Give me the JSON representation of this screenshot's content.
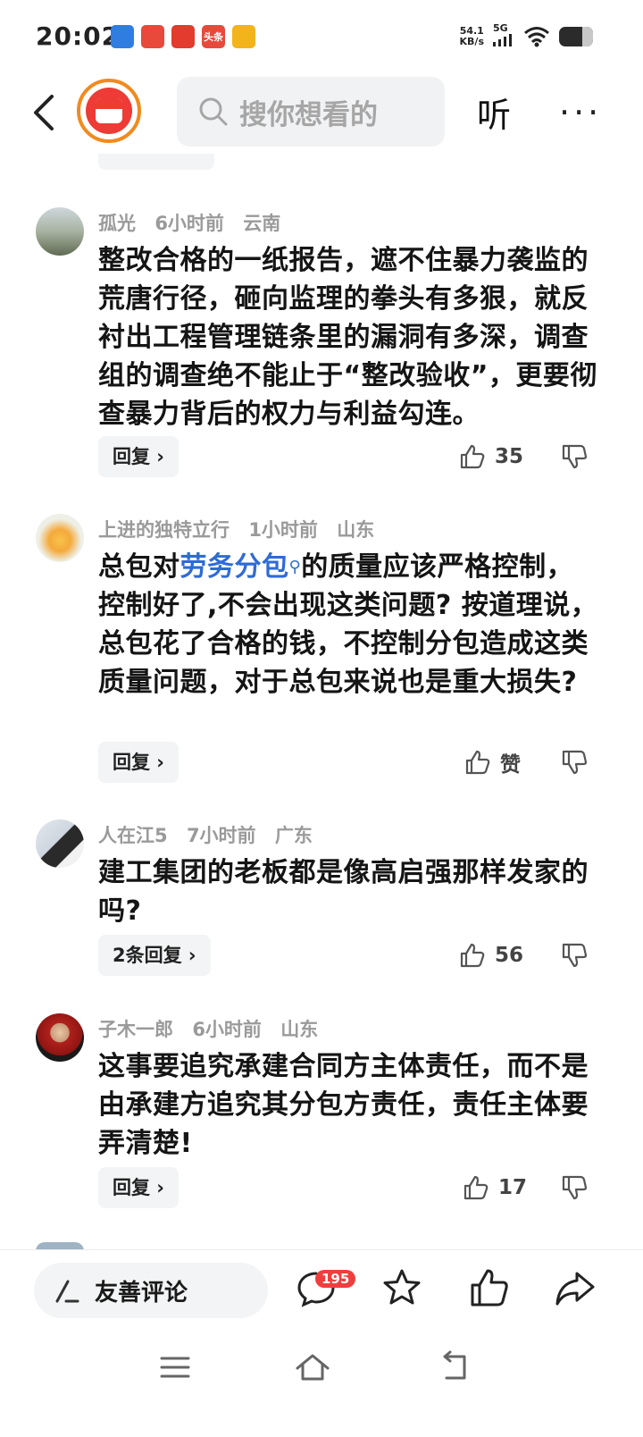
{
  "status_bar": {
    "time": "20:02",
    "net_speed_value": "54.1",
    "net_speed_unit": "KB/s",
    "network": "5G",
    "app_badges": [
      "头条"
    ]
  },
  "header": {
    "search_placeholder": "搜你想看的",
    "listen_label": "听",
    "more_label": "···"
  },
  "comments": [
    {
      "user": "孤光",
      "time": "6小时前",
      "location": "云南",
      "text": "整改合格的一纸报告，遮不住暴力袭监的荒唐行径，砸向监理的拳头有多狠，就反衬出工程管理链条里的漏洞有多深，调查组的调查绝不能止于“整改验收”，更要彻查暴力背后的权力与利益勾连。",
      "reply_label": "回复 ›",
      "likes": "35"
    },
    {
      "user": "上进的独特立行",
      "time": "1小时前",
      "location": "山东",
      "text_pre": "总包对",
      "text_link": "劳务分包",
      "text_post": "的质量应该严格控制，控制好了,不会出现这类问题? 按道理说，总包花了合格的钱，不控制分包造成这类质量问题，对于总包来说也是重大损失?",
      "reply_label": "回复 ›",
      "likes": "赞"
    },
    {
      "user": "人在江5",
      "time": "7小时前",
      "location": "广东",
      "text": "建工集团的老板都是像高启强那样发家的吗?",
      "reply_label": "2条回复 ›",
      "likes": "56"
    },
    {
      "user": "子木一郎",
      "time": "6小时前",
      "location": "山东",
      "text": "这事要追究承建合同方主体责任，而不是由承建方追究其分包方责任，责任主体要弄清楚!",
      "reply_label": "回复 ›",
      "likes": "17"
    }
  ],
  "bottom_bar": {
    "friendly_comment_label": "友善评论",
    "comment_count": "195"
  },
  "colors": {
    "link": "#2f6bd6",
    "badge": "#f03e3e",
    "logo_red": "#ee3b35",
    "logo_ring": "#f28a1f"
  }
}
